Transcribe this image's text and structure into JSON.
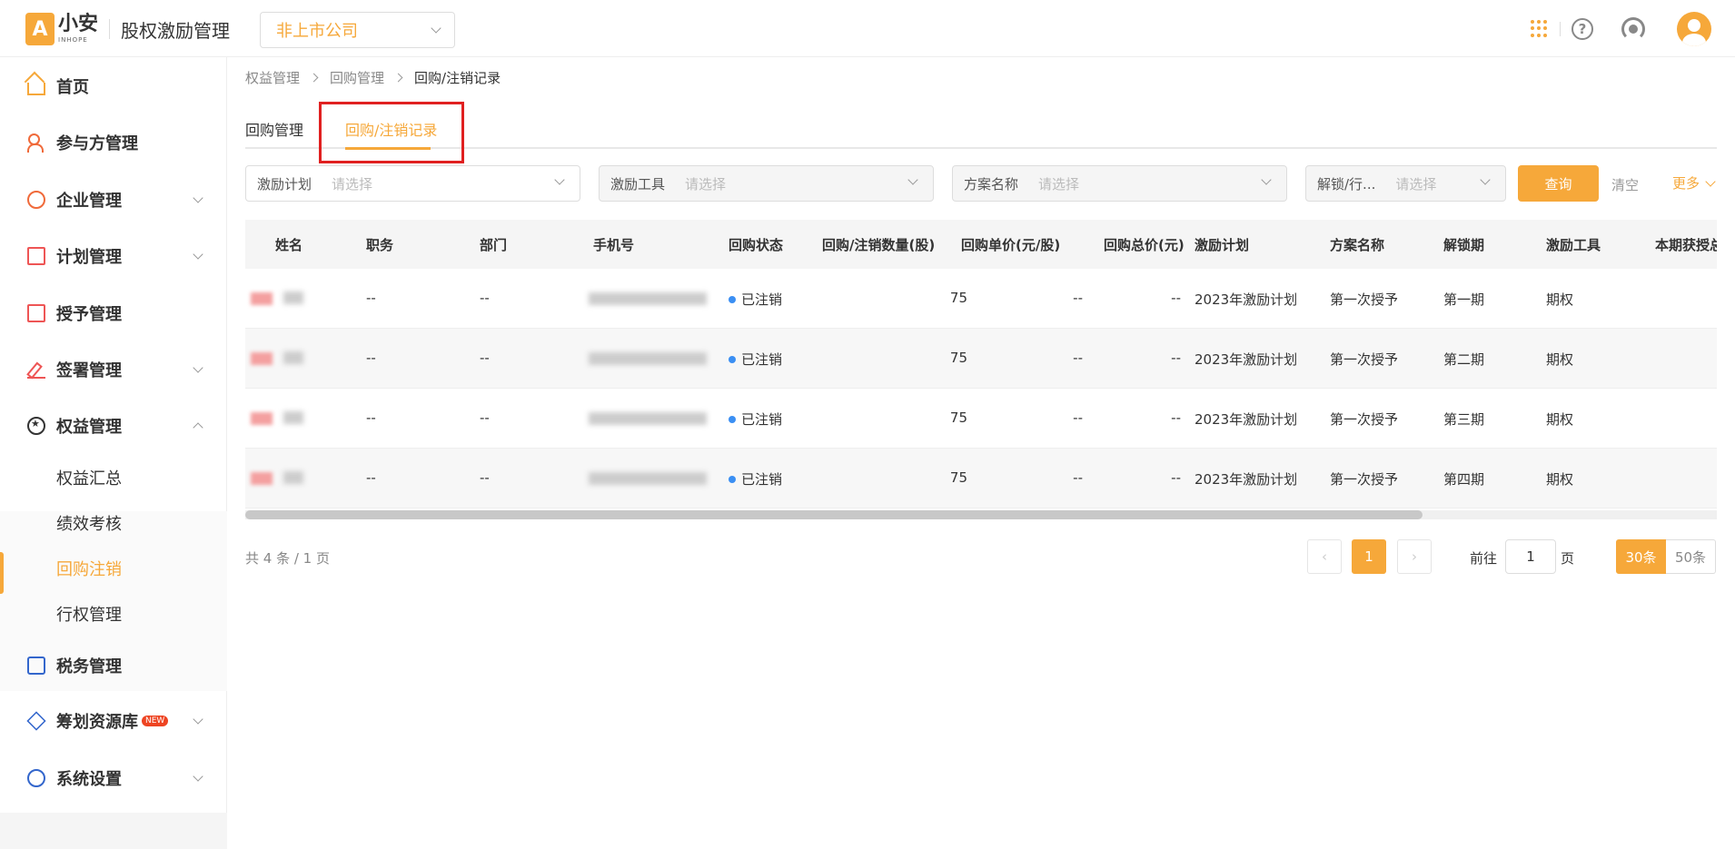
{
  "header": {
    "logo_name": "小安",
    "logo_sub": "INHOPE",
    "app_title": "股权激励管理",
    "company_select": "非上市公司"
  },
  "sidebar": {
    "items": [
      {
        "label": "首页",
        "icon": "home-icon"
      },
      {
        "label": "参与方管理",
        "icon": "users-icon"
      },
      {
        "label": "企业管理",
        "icon": "company-icon"
      },
      {
        "label": "计划管理",
        "icon": "plan-icon"
      },
      {
        "label": "授予管理",
        "icon": "grant-icon"
      },
      {
        "label": "签署管理",
        "icon": "sign-icon"
      },
      {
        "label": "权益管理",
        "icon": "equity-icon"
      },
      {
        "label": "税务管理",
        "icon": "tax-icon"
      },
      {
        "label": "筹划资源库",
        "icon": "layers-icon",
        "badge": "NEW"
      },
      {
        "label": "系统设置",
        "icon": "settings-icon"
      }
    ],
    "sub_items": [
      "权益汇总",
      "绩效考核",
      "回购注销",
      "行权管理"
    ],
    "active_sub": "回购注销"
  },
  "breadcrumb": [
    "权益管理",
    "回购管理",
    "回购/注销记录"
  ],
  "tabs": [
    "回购管理",
    "回购/注销记录"
  ],
  "filters": [
    {
      "label": "激励计划",
      "placeholder": "请选择"
    },
    {
      "label": "激励工具",
      "placeholder": "请选择"
    },
    {
      "label": "方案名称",
      "placeholder": "请选择"
    },
    {
      "label": "解锁/行...",
      "placeholder": "请选择"
    }
  ],
  "actions": {
    "query": "查询",
    "clear": "清空",
    "more": "更多"
  },
  "table": {
    "columns": [
      "姓名",
      "职务",
      "部门",
      "手机号",
      "回购状态",
      "回购/注销数量(股)",
      "回购单价(元/股)",
      "回购总价(元)",
      "激励计划",
      "方案名称",
      "解锁期",
      "激励工具",
      "本期获授总"
    ],
    "rows": [
      {
        "title": "--",
        "dept": "--",
        "status": "已注销",
        "qty": "75",
        "price": "--",
        "total": "--",
        "plan": "2023年激励计划",
        "scheme": "第一次授予",
        "period": "第一期",
        "tool": "期权"
      },
      {
        "title": "--",
        "dept": "--",
        "status": "已注销",
        "qty": "75",
        "price": "--",
        "total": "--",
        "plan": "2023年激励计划",
        "scheme": "第一次授予",
        "period": "第二期",
        "tool": "期权"
      },
      {
        "title": "--",
        "dept": "--",
        "status": "已注销",
        "qty": "75",
        "price": "--",
        "total": "--",
        "plan": "2023年激励计划",
        "scheme": "第一次授予",
        "period": "第三期",
        "tool": "期权"
      },
      {
        "title": "--",
        "dept": "--",
        "status": "已注销",
        "qty": "75",
        "price": "--",
        "total": "--",
        "plan": "2023年激励计划",
        "scheme": "第一次授予",
        "period": "第四期",
        "tool": "期权"
      }
    ],
    "status_color": "#3b8ff3",
    "horizontal_scroll_fraction": 0.8
  },
  "pagination": {
    "total_text": "共 4 条 / 1 页",
    "current_page": "1",
    "goto_prefix": "前往",
    "goto_value": "1",
    "goto_suffix": "页",
    "sizes": [
      "30条",
      "50条"
    ],
    "active_size": "30条"
  },
  "colors": {
    "accent": "#f6a83a",
    "highlight_box": "#e02020"
  }
}
